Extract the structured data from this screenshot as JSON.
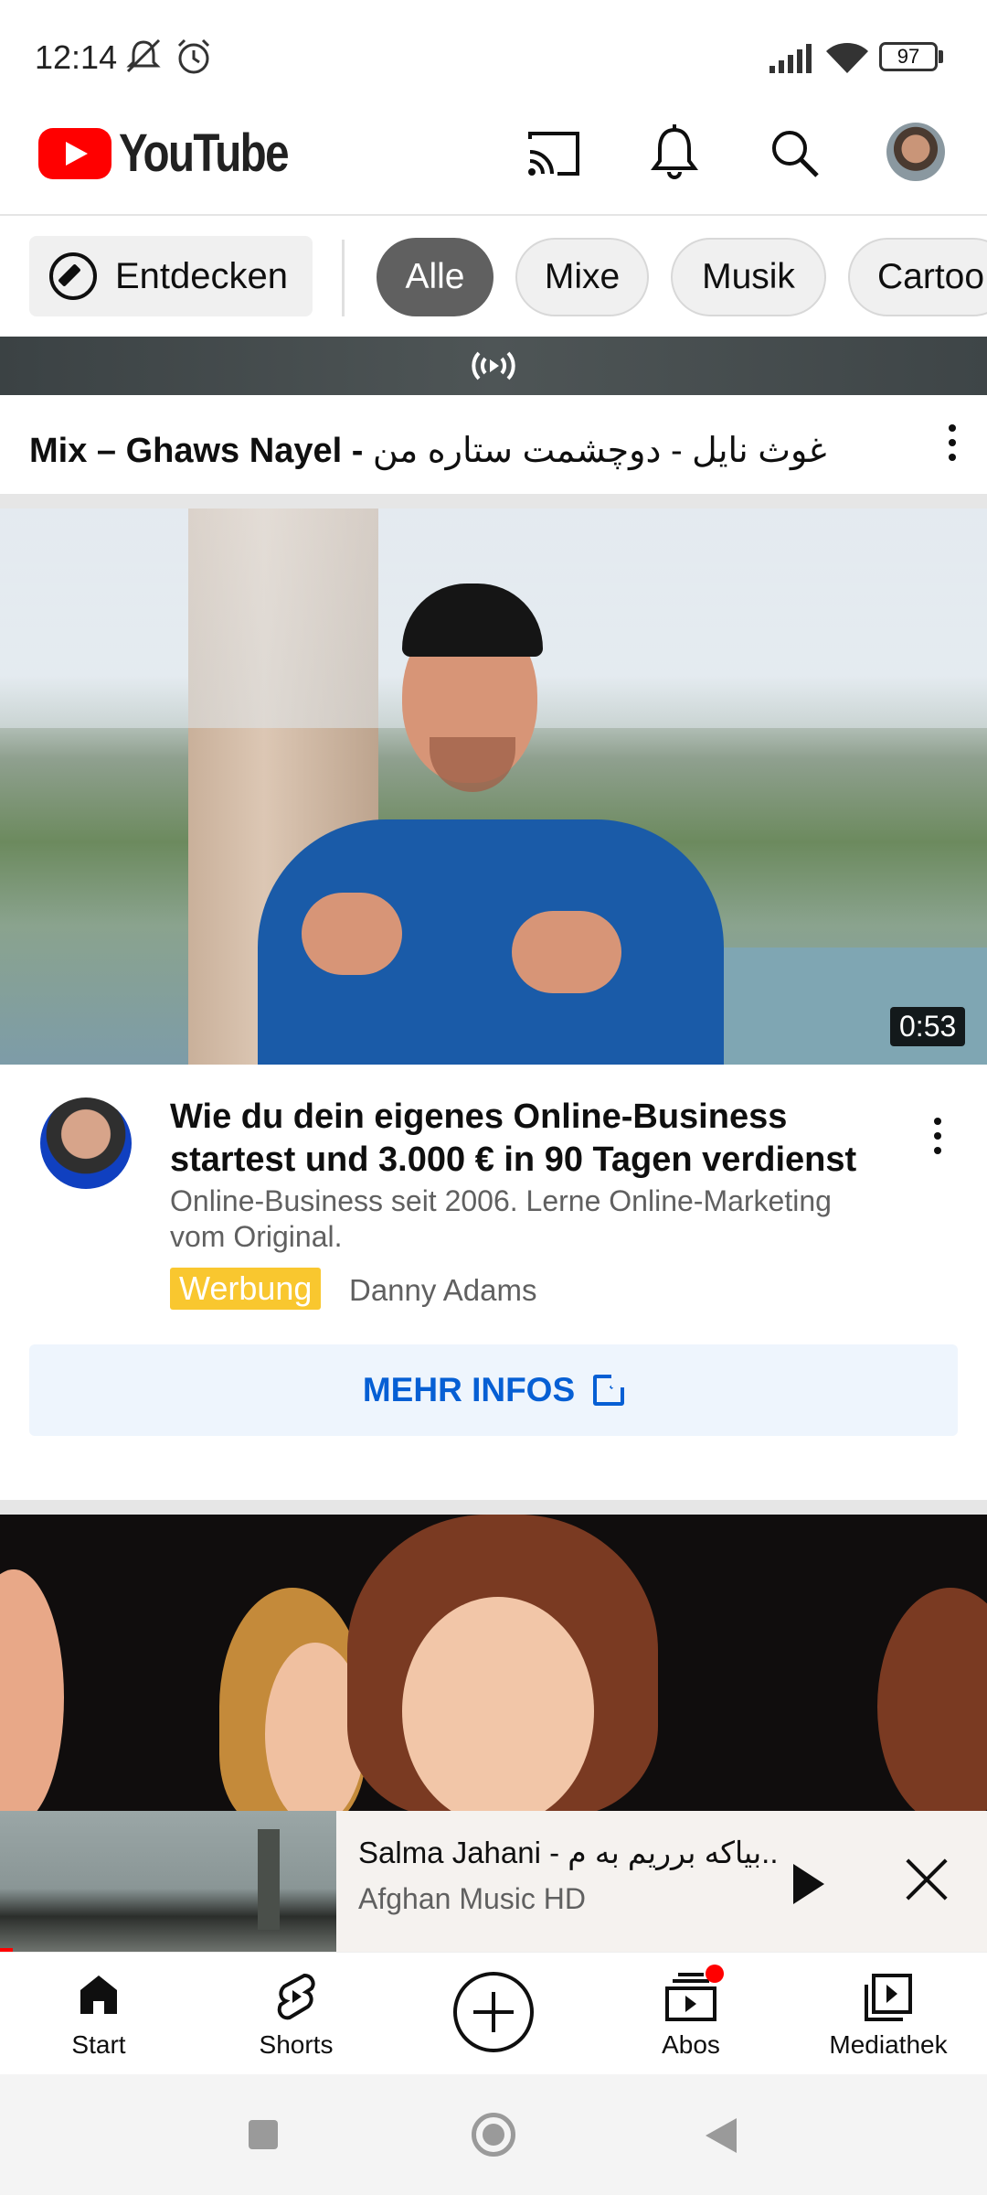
{
  "status_bar": {
    "time": "12:14",
    "battery": "97"
  },
  "app_bar": {
    "logo_text": "YouTube",
    "icons": [
      "cast-icon",
      "bell-icon",
      "search-icon",
      "account-avatar"
    ]
  },
  "chips": {
    "explore_label": "Entdecken",
    "items": [
      "Alle",
      "Mixe",
      "Musik",
      "Cartoo"
    ],
    "selected": "Alle"
  },
  "mix": {
    "title_latin": "Mix – Ghaws Nayel - ",
    "title_farsi": "غوث نايل - دوچشمت ستاره من"
  },
  "ad": {
    "duration": "0:53",
    "title": "Wie du dein eigenes Online-Business startest und 3.000 € in 90 Tagen verdienst",
    "description": "Online-Business seit 2006. Lerne Online-Marketing vom Original.",
    "badge": "Werbung",
    "advertiser": "Danny Adams",
    "cta": "MEHR INFOS"
  },
  "mini_player": {
    "title_latin": "Salma Jahani - ",
    "title_farsi": "بیاکه برریم به م..",
    "channel": "Afghan Music HD"
  },
  "bottom_nav": {
    "start": "Start",
    "shorts": "Shorts",
    "abos": "Abos",
    "library": "Mediathek"
  },
  "colors": {
    "brand_red": "#ff0000",
    "cta_blue": "#065fd4",
    "ad_badge": "#f9c72f"
  }
}
